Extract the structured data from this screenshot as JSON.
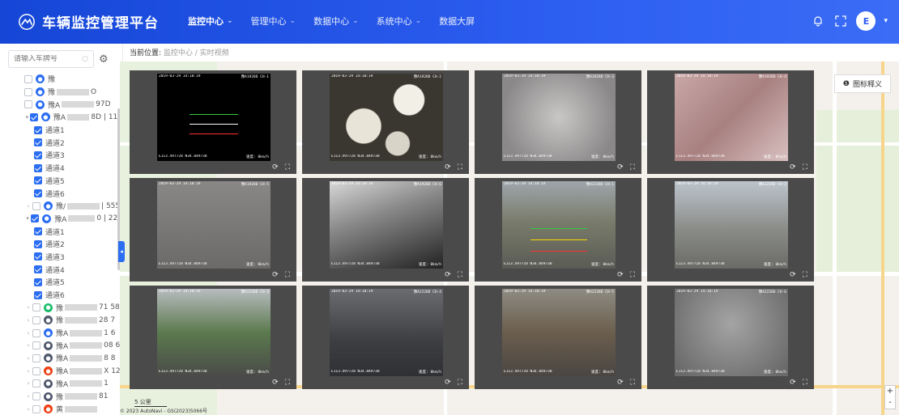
{
  "app": {
    "title": "车辆监控管理平台",
    "logo_icon": "logo-icon"
  },
  "nav": [
    {
      "label": "监控中心",
      "active": true
    },
    {
      "label": "管理中心",
      "active": false
    },
    {
      "label": "数据中心",
      "active": false
    },
    {
      "label": "系统中心",
      "active": false
    },
    {
      "label": "数据大屏",
      "active": false
    }
  ],
  "header_icons": [
    "bell-icon",
    "fullscreen-icon"
  ],
  "user": {
    "avatar_text": "E"
  },
  "search": {
    "placeholder": "请输入车牌号"
  },
  "breadcrumb": {
    "label": "当前位置:",
    "path": "监控中心 / 实时视频"
  },
  "legend": {
    "label": "图标释义"
  },
  "tree": [
    {
      "indent": 1,
      "checked": false,
      "icon_color": "#2c6ef2",
      "text": "豫"
    },
    {
      "indent": 1,
      "checked": false,
      "icon_color": "#2c6ef2",
      "text": "豫",
      "suffix": "O"
    },
    {
      "indent": 1,
      "checked": false,
      "icon_color": "#2c6ef2",
      "text": "豫A",
      "suffix": "97D"
    },
    {
      "indent": 0,
      "checked": true,
      "expanded": true,
      "icon_color": "#2c6ef2",
      "text": "豫A",
      "suffix": "8D | 111"
    },
    {
      "indent": 2,
      "checked": true,
      "text": "通道1"
    },
    {
      "indent": 2,
      "checked": true,
      "text": "通道2"
    },
    {
      "indent": 2,
      "checked": true,
      "text": "通道3"
    },
    {
      "indent": 2,
      "checked": true,
      "text": "通道4"
    },
    {
      "indent": 2,
      "checked": true,
      "text": "通道5"
    },
    {
      "indent": 2,
      "checked": true,
      "text": "通道6"
    },
    {
      "indent": 0,
      "checked": false,
      "icon_color": "#2c6ef2",
      "text": "豫/",
      "suffix": "| 555"
    },
    {
      "indent": 0,
      "checked": true,
      "expanded": true,
      "icon_color": "#2c6ef2",
      "text": "豫A",
      "suffix": "0 | 222"
    },
    {
      "indent": 2,
      "checked": true,
      "text": "通道1"
    },
    {
      "indent": 2,
      "checked": true,
      "text": "通道2"
    },
    {
      "indent": 2,
      "checked": true,
      "text": "通道3"
    },
    {
      "indent": 2,
      "checked": true,
      "text": "通道4"
    },
    {
      "indent": 2,
      "checked": true,
      "text": "通道5"
    },
    {
      "indent": 2,
      "checked": true,
      "text": "通道6"
    },
    {
      "indent": 0,
      "checked": false,
      "icon_color": "#19be6b",
      "text": "豫",
      "suffix": "71 58"
    },
    {
      "indent": 0,
      "checked": false,
      "icon_color": "#515a6e",
      "text": "豫",
      "suffix": "28 7"
    },
    {
      "indent": 0,
      "checked": false,
      "icon_color": "#2c6ef2",
      "text": "豫A",
      "suffix": "1 6"
    },
    {
      "indent": 0,
      "checked": false,
      "icon_color": "#515a6e",
      "text": "豫A",
      "suffix": "08 6"
    },
    {
      "indent": 0,
      "checked": false,
      "icon_color": "#515a6e",
      "text": "豫A",
      "suffix": "8 8"
    },
    {
      "indent": 0,
      "checked": false,
      "icon_color": "#ed4014",
      "text": "豫A",
      "suffix": "X 12"
    },
    {
      "indent": 0,
      "checked": false,
      "icon_color": "#515a6e",
      "text": "豫A",
      "suffix": "1"
    },
    {
      "indent": 0,
      "checked": false,
      "icon_color": "#515a6e",
      "text": "豫",
      "suffix": "81"
    },
    {
      "indent": 0,
      "checked": false,
      "icon_color": "#ed4014",
      "text": "黄",
      "suffix": ""
    },
    {
      "indent": 0,
      "checked": false,
      "icon_color": "#515a6e",
      "text": "豫",
      "suffix": "0"
    }
  ],
  "videos": [
    {
      "osd_top_l": "2019-03-29 14:18:19",
      "osd_top_r": "豫A1928D CH-1",
      "osd_bot_l": "E113.497728 N34.849738",
      "osd_bot_r": "速度: 0km/h",
      "bg": "#0a0a0a",
      "scene": "dark"
    },
    {
      "osd_top_l": "2019-03-29 14:18:19",
      "osd_top_r": "豫A1928D CH-2",
      "osd_bot_l": "E113.497728 N34.849738",
      "osd_bot_r": "速度: 0km/h",
      "bg": "#3a3630",
      "scene": "blur"
    },
    {
      "osd_top_l": "2019-03-29 14:18:19",
      "osd_top_r": "豫A1928D CH-3",
      "osd_bot_l": "E113.497728 N34.849738",
      "osd_bot_r": "速度: 0km/h",
      "bg": "#9a9898",
      "scene": "fog"
    },
    {
      "osd_top_l": "2019-03-29 14:18:19",
      "osd_top_r": "豫A1928D CH-4",
      "osd_bot_l": "E113.497728 N34.849738",
      "osd_bot_r": "速度: 0km/h",
      "bg": "#b79a9a",
      "scene": "pink"
    },
    {
      "osd_top_l": "2019-03-29 14:18:19",
      "osd_top_r": "豫A1928D CH-5",
      "osd_bot_l": "E113.497728 N34.849738",
      "osd_bot_r": "速度: 0km/h",
      "bg": "#7a7876",
      "scene": "floor"
    },
    {
      "osd_top_l": "2019-03-29 14:18:19",
      "osd_top_r": "豫A1928D CH-6",
      "osd_bot_l": "E113.497728 N34.849738",
      "osd_bot_r": "速度: 0km/h",
      "bg": "#5c5c5c",
      "scene": "bw"
    },
    {
      "osd_top_l": "2019-03-29 14:18:19",
      "osd_top_r": "豫A2228D CH-1",
      "osd_bot_l": "E113.497728 N34.849738",
      "osd_bot_r": "速度: 0km/h",
      "bg": "#6b6a62",
      "scene": "street"
    },
    {
      "osd_top_l": "2019-03-29 14:18:19",
      "osd_top_r": "豫A2228D CH-2",
      "osd_bot_l": "E113.497728 N34.849738",
      "osd_bot_r": "速度: 0km/h",
      "bg": "#7e7f80",
      "scene": "street2"
    },
    {
      "osd_top_l": "2019-03-29 14:18:19",
      "osd_top_r": "豫A2228D CH-3",
      "osd_bot_l": "E113.497728 N34.849738",
      "osd_bot_r": "速度: 0km/h",
      "bg": "#5b6a58",
      "scene": "trees"
    },
    {
      "osd_top_l": "2019-03-29 14:18:19",
      "osd_top_r": "豫A2228D CH-4",
      "osd_bot_l": "E113.497728 N34.849738",
      "osd_bot_r": "速度: 0km/h",
      "bg": "#555a5e",
      "scene": "road"
    },
    {
      "osd_top_l": "2019-03-29 14:18:19",
      "osd_top_r": "豫A2228D CH-5",
      "osd_bot_l": "E113.497728 N34.849738",
      "osd_bot_r": "速度: 0km/h",
      "bg": "#5d5a55",
      "scene": "building"
    },
    {
      "osd_top_l": "2019-03-29 14:18:19",
      "osd_top_r": "豫A2228D CH-6",
      "osd_bot_l": "E113.497728 N34.849738",
      "osd_bot_r": "速度: 0km/h",
      "bg": "#6a6a6a",
      "scene": "fog2"
    }
  ],
  "video_controls": [
    "refresh-icon",
    "fullscreen-icon"
  ],
  "map": {
    "scale_label": "5 公里",
    "attribution": "© 2023 AutoNavi - GS(2023)5066号",
    "zoom_in": "+",
    "zoom_out": "-"
  }
}
